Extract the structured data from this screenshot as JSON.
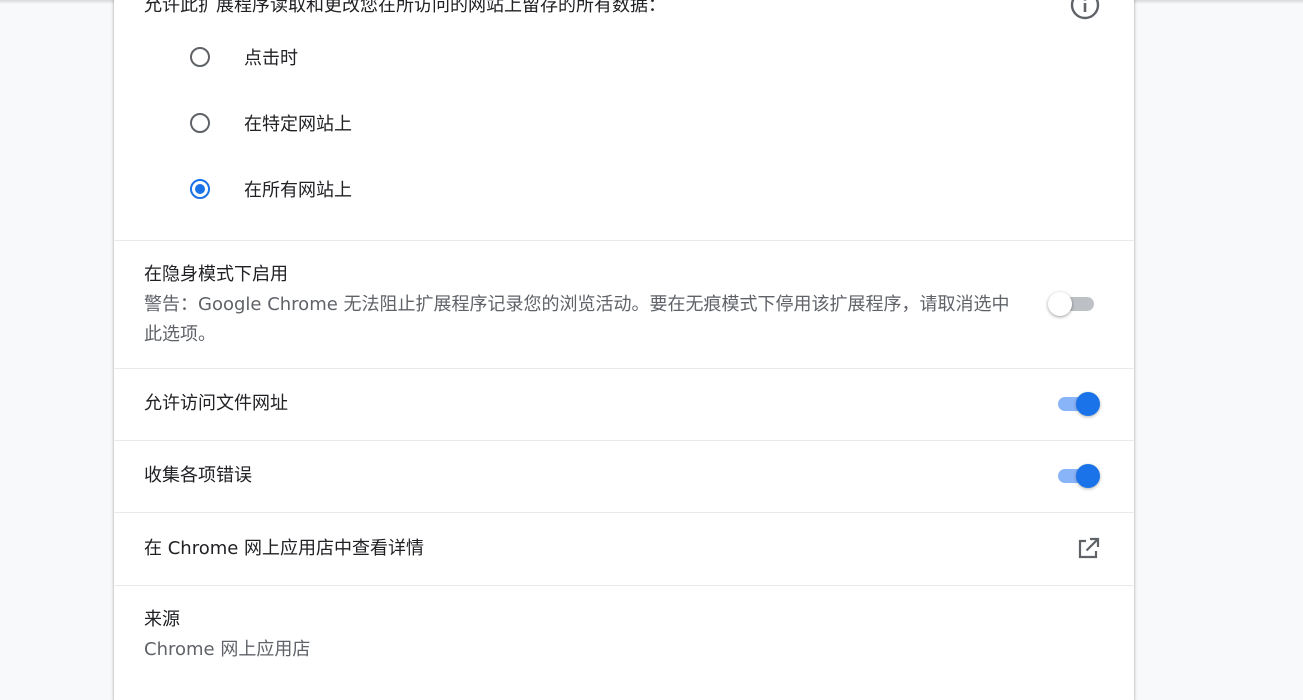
{
  "site_access": {
    "title": "允许此扩展程序读取和更改您在所访问的网站上留存的所有数据：",
    "info_icon": "info-circle-icon",
    "options": [
      {
        "label": "点击时",
        "selected": false
      },
      {
        "label": "在特定网站上",
        "selected": false
      },
      {
        "label": "在所有网站上",
        "selected": true
      }
    ]
  },
  "incognito": {
    "title": "在隐身模式下启用",
    "warning": "警告：Google Chrome 无法阻止扩展程序记录您的浏览活动。要在无痕模式下停用该扩展程序，请取消选中此选项。",
    "enabled": false
  },
  "file_urls": {
    "title": "允许访问文件网址",
    "enabled": true
  },
  "collect_errors": {
    "title": "收集各项错误",
    "enabled": true
  },
  "store_link": {
    "title": "在 Chrome 网上应用店中查看详情",
    "icon": "open-in-new-icon"
  },
  "source": {
    "title": "来源",
    "value": "Chrome 网上应用店"
  },
  "colors": {
    "accent": "#1a73e8",
    "accent_light": "#8ab4f8",
    "toggle_off_track": "#bdc1c6",
    "secondary_text": "#5f6368"
  }
}
